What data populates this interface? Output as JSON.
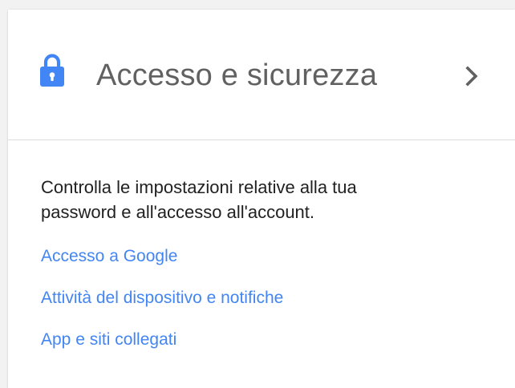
{
  "card": {
    "title": "Accesso e sicurezza",
    "icon": "lock-icon",
    "chevron_icon": "chevron-right-icon",
    "description_line1": "Controlla le impostazioni relative alla tua",
    "description_line2": "password e all'accesso all'account.",
    "links": [
      {
        "label": "Accesso a Google"
      },
      {
        "label": "Attività del dispositivo e notifiche"
      },
      {
        "label": "App e siti collegati"
      }
    ]
  },
  "colors": {
    "accent": "#4285f4",
    "title_text": "#616161",
    "body_text": "#212121",
    "divider": "#dcdcdc",
    "background": "#f2f2f2"
  }
}
